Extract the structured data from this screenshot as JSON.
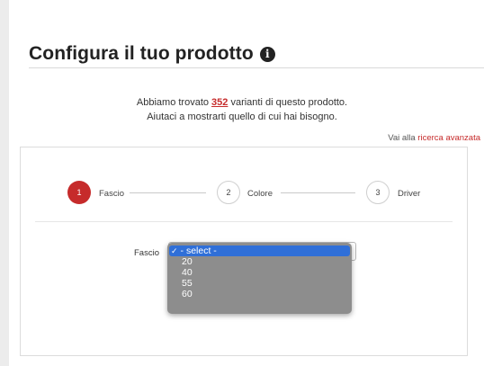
{
  "page": {
    "title": "Configura il tuo prodotto",
    "info_icon": "i"
  },
  "results": {
    "prefix": "Abbiamo trovato ",
    "count": "352",
    "suffix": " varianti di questo prodotto.",
    "line2": "Aiutaci a mostrarti quello di cui hai bisogno."
  },
  "advanced": {
    "prefix": "Vai alla ",
    "link": "ricerca avanzata"
  },
  "steps": [
    {
      "number": "1",
      "label": "Fascio",
      "active": true
    },
    {
      "number": "2",
      "label": "Colore",
      "active": false
    },
    {
      "number": "3",
      "label": "Driver",
      "active": false
    }
  ],
  "form": {
    "field_label": "Fascio",
    "select_arrow": "⌄",
    "options": [
      {
        "label": "- select -",
        "selected": true,
        "check": "✓"
      },
      {
        "label": "20"
      },
      {
        "label": "40"
      },
      {
        "label": "55"
      },
      {
        "label": "60"
      }
    ]
  },
  "colors": {
    "accent": "#c62b2b",
    "highlight": "#2f6fd8",
    "dropdown_bg": "#8d8d8d"
  }
}
